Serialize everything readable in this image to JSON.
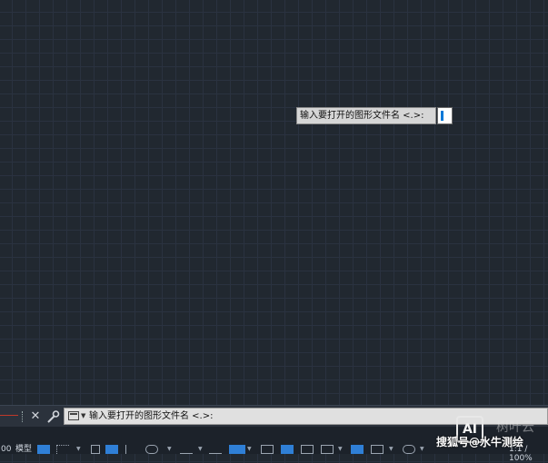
{
  "canvas": {
    "prompt_label": "输入要打开的图形文件名 <.>:"
  },
  "command_line": {
    "text": "输入要打开的图形文件名 <.>:"
  },
  "status_bar": {
    "left_partial": "00",
    "model_tab": "模型",
    "scale": "1:1 / 100%"
  },
  "watermark": {
    "logo": "AI",
    "top_text": "树叶云",
    "bottom_text": "搜狐号@水牛测绘"
  },
  "colors": {
    "background": "#212830",
    "accent": "#2f7fd6"
  }
}
